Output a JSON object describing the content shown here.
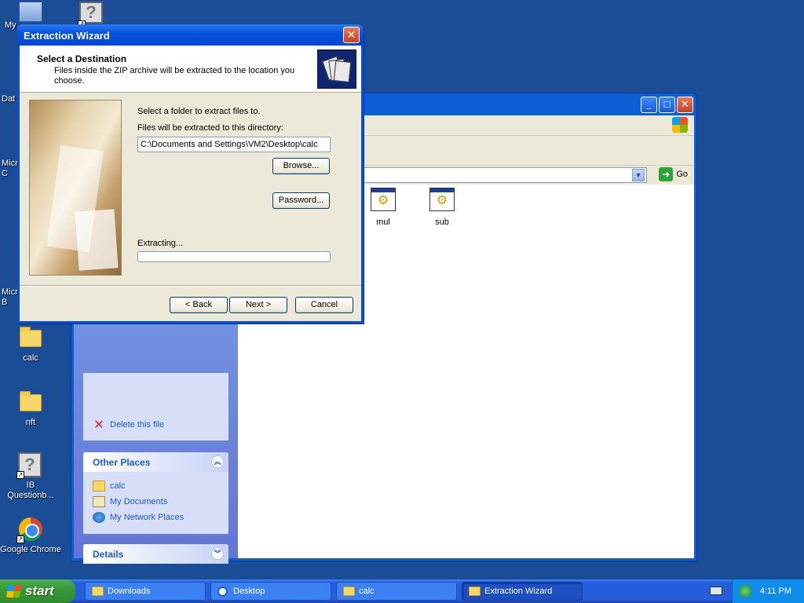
{
  "desktop": {
    "icons": [
      {
        "name": "my-computer",
        "label": "My"
      },
      {
        "name": "shortcut-top",
        "label": ""
      },
      {
        "name": "data",
        "label": "Dat"
      },
      {
        "name": "microsoft-1",
        "label": "Micro\nC"
      },
      {
        "name": "microsoft-2",
        "label": "Micro\nB"
      },
      {
        "name": "calc-folder",
        "label": "calc"
      },
      {
        "name": "nft-folder",
        "label": "nft"
      },
      {
        "name": "ib-questionbank",
        "label": "IB\nQuestionb..."
      },
      {
        "name": "google-chrome",
        "label": "Google Chrome"
      }
    ]
  },
  "explorer": {
    "address_go": "Go",
    "tasks": {
      "delete_label": "Delete this file"
    },
    "other_places": {
      "title": "Other Places",
      "items": [
        "calc",
        "My Documents",
        "My Network Places"
      ]
    },
    "details": {
      "title": "Details"
    },
    "files": [
      {
        "label": "mul"
      },
      {
        "label": "sub"
      }
    ]
  },
  "wizard": {
    "title": "Extraction Wizard",
    "header_title": "Select a Destination",
    "header_desc": "Files inside the ZIP archive will be extracted to the location you choose.",
    "select_folder_text": "Select a folder to extract files to.",
    "directory_label": "Files will be extracted to this directory:",
    "directory_value": "C:\\Documents and Settings\\VM2\\Desktop\\calc",
    "browse_label": "Browse...",
    "password_label": "Password...",
    "extracting_label": "Extracting...",
    "progress_fraction": 0,
    "back_label": "< Back",
    "next_label": "Next >",
    "cancel_label": "Cancel"
  },
  "taskbar": {
    "start_label": "start",
    "buttons": [
      {
        "label": "Downloads",
        "active": false
      },
      {
        "label": "Desktop",
        "active": false
      },
      {
        "label": "calc",
        "active": false
      },
      {
        "label": "Extraction Wizard",
        "active": true
      }
    ],
    "clock": "4:11 PM"
  },
  "colors": {
    "desktop_bg": "#1b4d96",
    "titlebar_blue": "#0a52dd",
    "dialog_face": "#ece9d8",
    "link_blue": "#215dc6"
  }
}
